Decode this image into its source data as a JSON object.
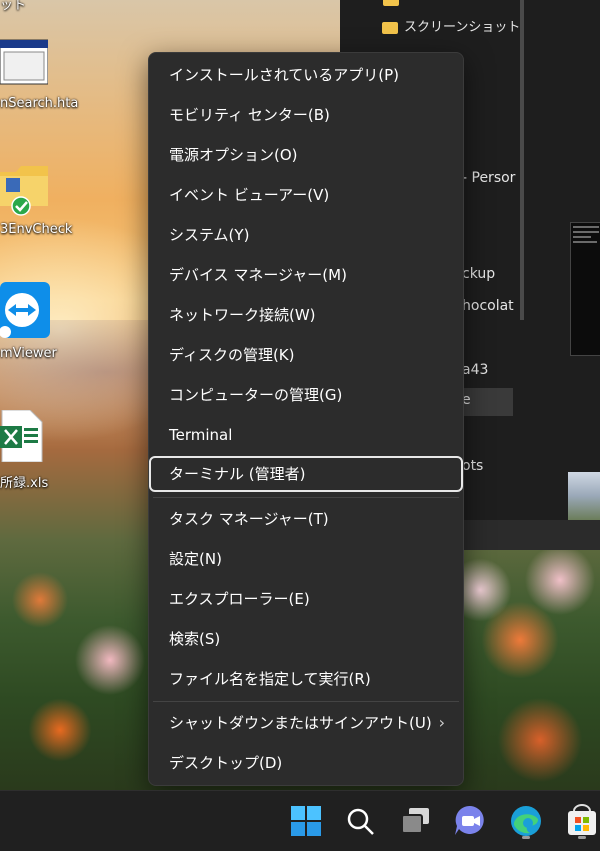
{
  "desktop": {
    "icons": [
      {
        "label": "ット",
        "icon": "shortcut-icon"
      },
      {
        "label": "nSearch.hta",
        "icon": "hta-window-icon"
      },
      {
        "label": "3EnvCheck",
        "icon": "folder-check-icon"
      },
      {
        "label": "mViewer",
        "icon": "teamviewer-icon"
      },
      {
        "label": "所録.xls",
        "icon": "excel-icon"
      }
    ]
  },
  "explorer": {
    "items": [
      "スクリーンショット",
      "- Persor",
      "ckup",
      "hocolat",
      "a43",
      "e",
      "ots"
    ]
  },
  "menu": {
    "items": [
      {
        "label": "インストールされているアプリ(P)"
      },
      {
        "label": "モビリティ センター(B)"
      },
      {
        "label": "電源オプション(O)"
      },
      {
        "label": "イベント ビューアー(V)"
      },
      {
        "label": "システム(Y)"
      },
      {
        "label": "デバイス マネージャー(M)"
      },
      {
        "label": "ネットワーク接続(W)"
      },
      {
        "label": "ディスクの管理(K)"
      },
      {
        "label": "コンピューターの管理(G)"
      },
      {
        "label": "Terminal"
      },
      {
        "label": "ターミナル (管理者)",
        "focused": true
      },
      {
        "label": "タスク マネージャー(T)"
      },
      {
        "label": "設定(N)"
      },
      {
        "label": "エクスプローラー(E)"
      },
      {
        "label": "検索(S)"
      },
      {
        "label": "ファイル名を指定して実行(R)"
      },
      {
        "label": "シャットダウンまたはサインアウト(U)",
        "submenu": true
      },
      {
        "label": "デスクトップ(D)"
      }
    ],
    "submenu_chevron": "›"
  },
  "taskbar": {
    "buttons": [
      {
        "icon": "windows-start-icon"
      },
      {
        "icon": "search-icon"
      },
      {
        "icon": "task-view-icon"
      },
      {
        "icon": "teams-chat-icon"
      },
      {
        "icon": "edge-browser-icon"
      },
      {
        "icon": "microsoft-store-icon"
      }
    ]
  },
  "colors": {
    "menu_bg": "#2c2c2c",
    "focus_border": "#e8e8e8",
    "taskbar_bg": "#202020",
    "folder": "#f2c34b"
  }
}
